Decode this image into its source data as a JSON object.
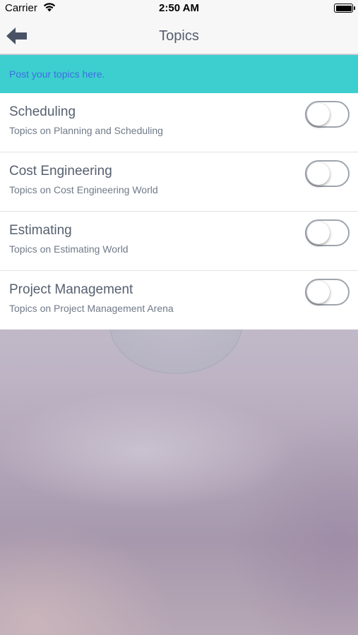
{
  "status_bar": {
    "carrier": "Carrier",
    "time": "2:50 AM"
  },
  "nav": {
    "title": "Topics",
    "back_icon": "back-arrow-icon"
  },
  "banner": {
    "text": "Post your topics here."
  },
  "topics": [
    {
      "title": "Scheduling",
      "subtitle": "Topics on Planning and Scheduling",
      "enabled": false
    },
    {
      "title": "Cost Engineering",
      "subtitle": "Topics on Cost Engineering World",
      "enabled": false
    },
    {
      "title": "Estimating",
      "subtitle": "Topics on Estimating World",
      "enabled": false
    },
    {
      "title": "Project Management",
      "subtitle": "Topics on Project Management Arena",
      "enabled": false
    }
  ],
  "colors": {
    "banner_bg": "#3dcfcf",
    "banner_text": "#3b6fe0",
    "title_text": "#56606f",
    "nav_bg": "#f7f7f7"
  }
}
